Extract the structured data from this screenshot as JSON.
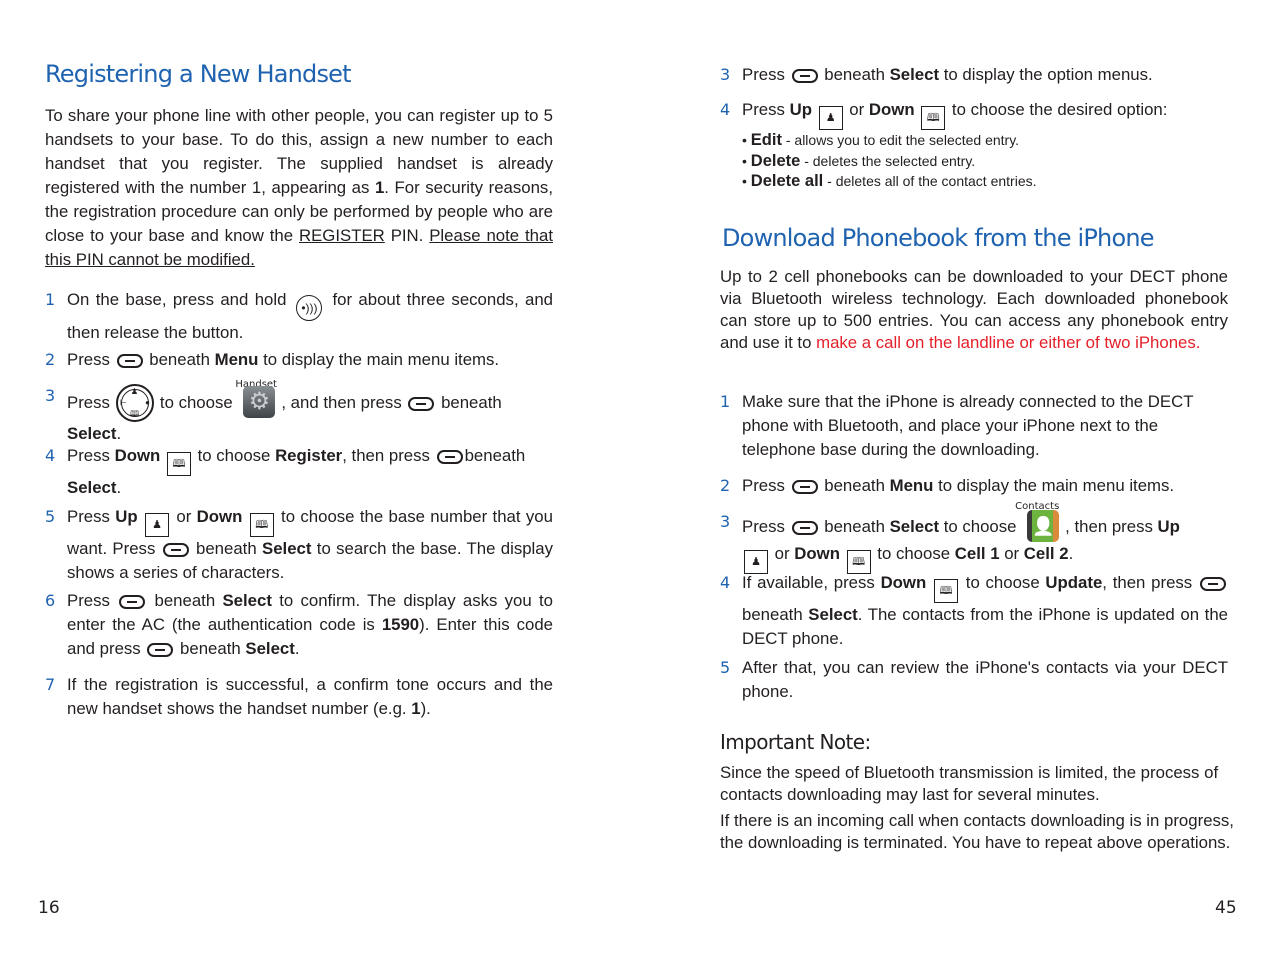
{
  "left_page": {
    "title": "Registering a New Handset",
    "intro": {
      "part1": "To share your phone line with other people, you can register up to 5 handsets to your base. To do this, assign a new number to each handset that you register. The supplied handset is already registered with the number 1, appearing as ",
      "bold1": "1",
      "part2": ". For security reasons, the registration procedure can only be performed by people who are close to your base and know the ",
      "underline1": "REGISTER",
      "part3": " PIN. ",
      "underline2": "Please note that this PIN cannot be modified."
    },
    "steps": [
      {
        "num": "1",
        "a": "On the base, press and hold",
        "b": "for about three seconds, and then release the button."
      },
      {
        "num": "2",
        "a": "Press",
        "b": "beneath",
        "bold": "Menu",
        "c": "to display the main menu items."
      },
      {
        "num": "3",
        "a": "Press",
        "b": "to choose",
        "icon_label": "Handset",
        "c": ", and then press",
        "d": "beneath",
        "bold": "Select",
        "e": "."
      },
      {
        "num": "4",
        "a": "Press",
        "bold1": "Down",
        "b": "to choose",
        "bold2": "Register",
        "c": ", then press",
        "d": "beneath",
        "bold3": "Select",
        "e": "."
      },
      {
        "num": "5",
        "a": "Press",
        "bold1": "Up",
        "b": "or",
        "bold2": "Down",
        "c": "to choose the base number that you want. Press",
        "d": "beneath",
        "bold3": "Select",
        "e": "to search the base. The display shows a series of characters."
      },
      {
        "num": "6",
        "a": "Press",
        "b": "beneath",
        "bold1": "Select",
        "c": "to confirm. The display asks you to enter the AC (the authentication code is",
        "bold2": "1590",
        "d": "). Enter this code and press",
        "e": "beneath",
        "bold3": "Select",
        "f": "."
      },
      {
        "num": "7",
        "a": "If the registration is successful, a confirm tone occurs and the new handset shows the handset number (e.g.",
        "bold": "1",
        "b": ")."
      }
    ],
    "page_number": "16"
  },
  "right_page": {
    "steps_top": [
      {
        "num": "3",
        "a": "Press",
        "b": "beneath",
        "bold": "Select",
        "c": "to display the option menus."
      },
      {
        "num": "4",
        "a": "Press",
        "bold1": "Up",
        "b": "or",
        "bold2": "Down",
        "c": "to choose the desired option:",
        "bullets": [
          {
            "label": "Edit",
            "text": " - allows you to edit the selected entry."
          },
          {
            "label": "Delete",
            "text": " - deletes the selected entry."
          },
          {
            "label": "Delete all",
            "text": " - deletes all of the contact entries."
          }
        ]
      }
    ],
    "title": "Download Phonebook from the iPhone",
    "intro": {
      "text": "Up to 2 cell phonebooks can be downloaded to your DECT phone via Bluetooth wireless technology. Each downloaded phonebook can store up to 500 entries. You can access any phonebook entry and use it to ",
      "highlight": "make a call on the landline or either of two iPhones."
    },
    "steps": [
      {
        "num": "1",
        "a": "Make sure that the iPhone is already connected to the DECT phone with Bluetooth, and place your iPhone next to the telephone base during the downloading."
      },
      {
        "num": "2",
        "a": "Press",
        "b": "beneath",
        "bold": "Menu",
        "c": "to display the main menu items."
      },
      {
        "num": "3",
        "a": "Press",
        "b": "beneath",
        "bold1": "Select",
        "c": "to choose",
        "icon_label": "Contacts",
        "d": ", then press",
        "bold2": "Up",
        "e": "or",
        "bold3": "Down",
        "f": "to choose",
        "bold4": "Cell 1",
        "g": "or",
        "bold5": "Cell 2",
        "h": "."
      },
      {
        "num": "4",
        "a": "If available, press",
        "bold1": "Down",
        "b": "to choose",
        "bold2": "Update",
        "c": ", then press",
        "d": "beneath",
        "bold3": "Select",
        "e": ". The contacts from the iPhone is updated on the DECT phone."
      },
      {
        "num": "5",
        "a": "After that, you can review the iPhone's contacts via your DECT phone."
      }
    ],
    "note": {
      "title": "Important Note:",
      "para1": "Since the speed of Bluetooth transmission is limited, the process of contacts downloading may last for several minutes.",
      "para2": "If there is an incoming call when contacts downloading is in progress, the downloading is terminated. You have to repeat above operations."
    },
    "page_number": "45"
  },
  "icons": {
    "softkey": "softkey-icon",
    "up_key": "up-key-icon",
    "down_key": "down-key-icon",
    "up_glyph": "⁷♟",
    "down_glyph": "🕮",
    "page_key": "page-key-icon",
    "page_glyph": "•))",
    "nav_key": "navigation-key-icon",
    "handset_app": "handset-settings-icon",
    "contacts_app": "contacts-icon"
  },
  "colors": {
    "heading": "#1f63b0",
    "highlight": "#e4202a",
    "text": "#231f20"
  }
}
